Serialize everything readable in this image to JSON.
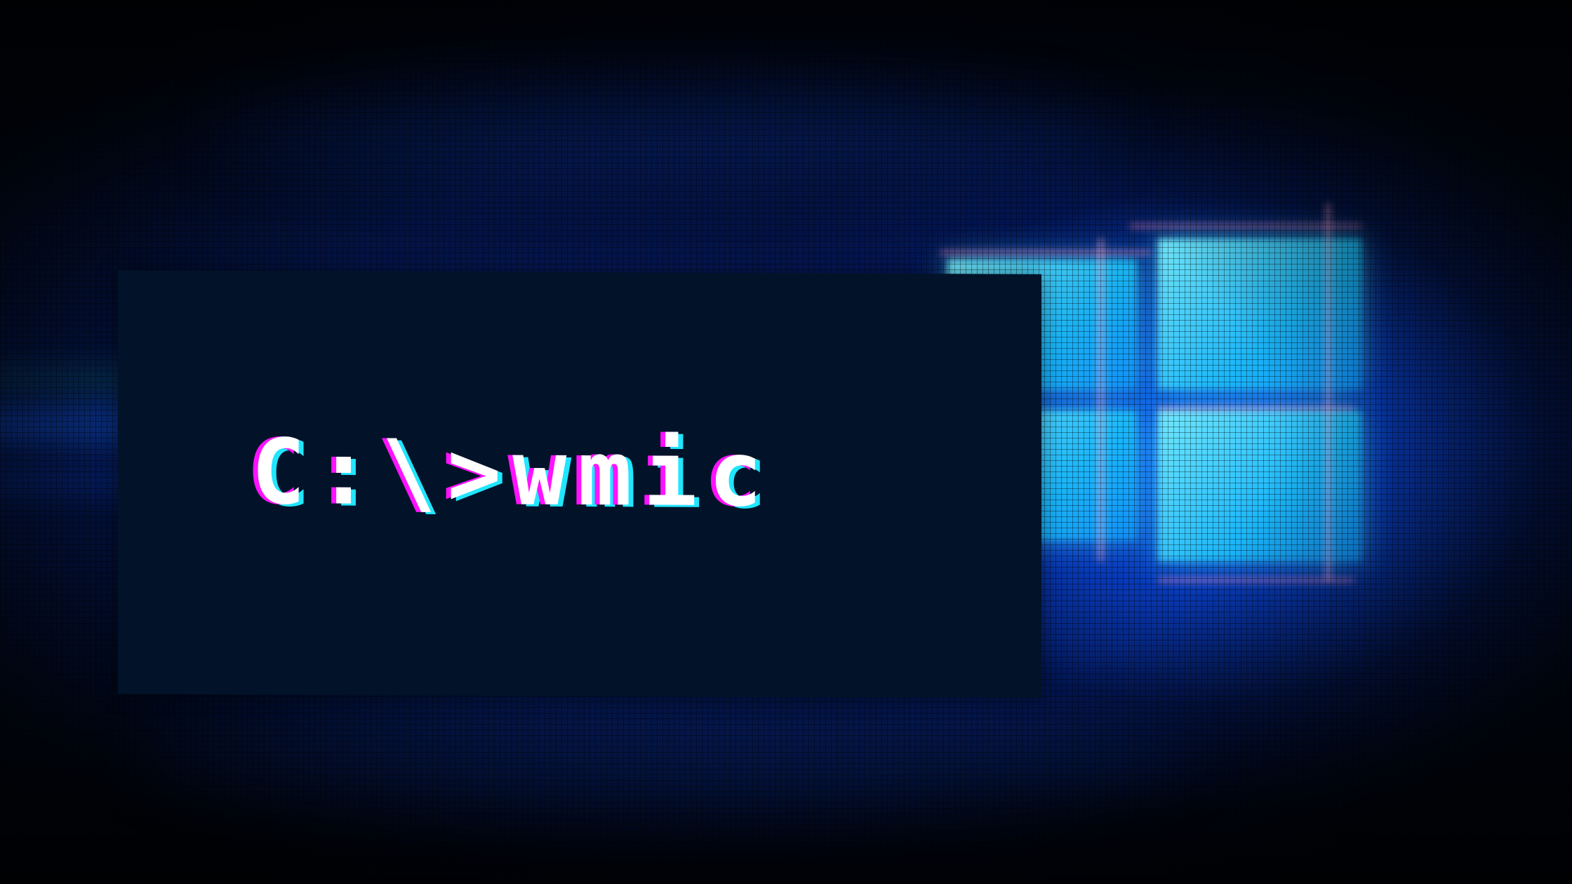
{
  "terminal": {
    "command": "C:\\>wmic"
  },
  "logo": {
    "icon": "windows-logo-icon"
  },
  "colors": {
    "panel": "#021329",
    "text": "#ffffff",
    "glitch_magenta": "#ff12ff",
    "glitch_cyan": "#20e6ff",
    "glow_blue": "#1466ff"
  }
}
